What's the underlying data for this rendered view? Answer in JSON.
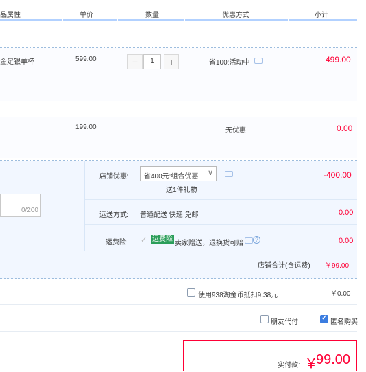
{
  "header": {
    "col_attr": "品属性",
    "col_price": "单价",
    "col_qty": "数量",
    "col_promo": "优惠方式",
    "col_subtotal": "小计"
  },
  "items": [
    {
      "name": "金足银单杯",
      "price": "599.00",
      "qty": "1",
      "minus": "−",
      "plus": "+",
      "promo": "省100:活动中",
      "subtotal": "499.00"
    },
    {
      "price": "199.00",
      "promo": "无优惠",
      "subtotal": "0.00"
    }
  ],
  "shop": {
    "message_counter": "0/200",
    "discount_label": "店铺优惠:",
    "discount_select": "省400元:组合优惠",
    "discount_gift": "送1件礼物",
    "discount_amount": "-400.00",
    "shipping_label": "运送方式:",
    "shipping_value": "普通配送 快递 免邮",
    "shipping_amount": "0.00",
    "insurance_label": "运费险:",
    "insurance_tag": "运费险",
    "insurance_text": "卖家赠送，退换货可赔",
    "insurance_amount": "0.00",
    "total_label": "店铺合计(含运费)",
    "total_value": "￥99.00"
  },
  "coins": {
    "label": "使用938淘金币抵扣9.38元",
    "value": "￥0.00"
  },
  "options": {
    "friend_pay": "朋友代付",
    "anonymous": "匿名购买"
  },
  "pay": {
    "label": "实付款:",
    "currency": "￥",
    "amount": "99.00"
  },
  "colors": {
    "accent_red": "#ff0036",
    "border_blue": "#b2d1ff",
    "row_bg": "#fbfcff",
    "panel_bg": "#f2f7ff"
  }
}
